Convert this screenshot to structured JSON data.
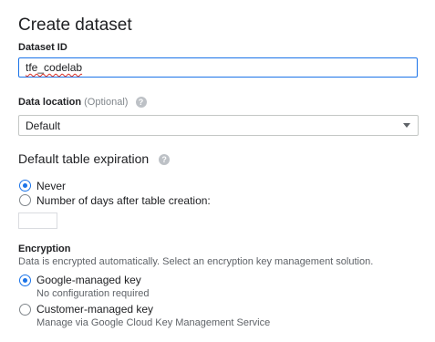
{
  "form": {
    "title": "Create dataset",
    "dataset_id": {
      "label": "Dataset ID",
      "value": "tfe_codelab"
    },
    "data_location": {
      "label": "Data location",
      "optional": "(Optional)",
      "selected": "Default"
    },
    "table_expiration": {
      "title": "Default table expiration",
      "options": [
        {
          "label": "Never",
          "selected": true
        },
        {
          "label": "Number of days after table creation:",
          "selected": false
        }
      ],
      "days_value": ""
    },
    "encryption": {
      "title": "Encryption",
      "description": "Data is encrypted automatically. Select an encryption key management solution.",
      "options": [
        {
          "label": "Google-managed key",
          "sublabel": "No configuration required",
          "selected": true
        },
        {
          "label": "Customer-managed key",
          "sublabel": "Manage via Google Cloud Key Management Service",
          "selected": false
        }
      ]
    }
  },
  "icons": {
    "help": "help-circle-icon",
    "dropdown": "caret-down-icon"
  },
  "colors": {
    "accent": "#1a73e8",
    "text": "#202124",
    "muted": "#5f6368"
  }
}
